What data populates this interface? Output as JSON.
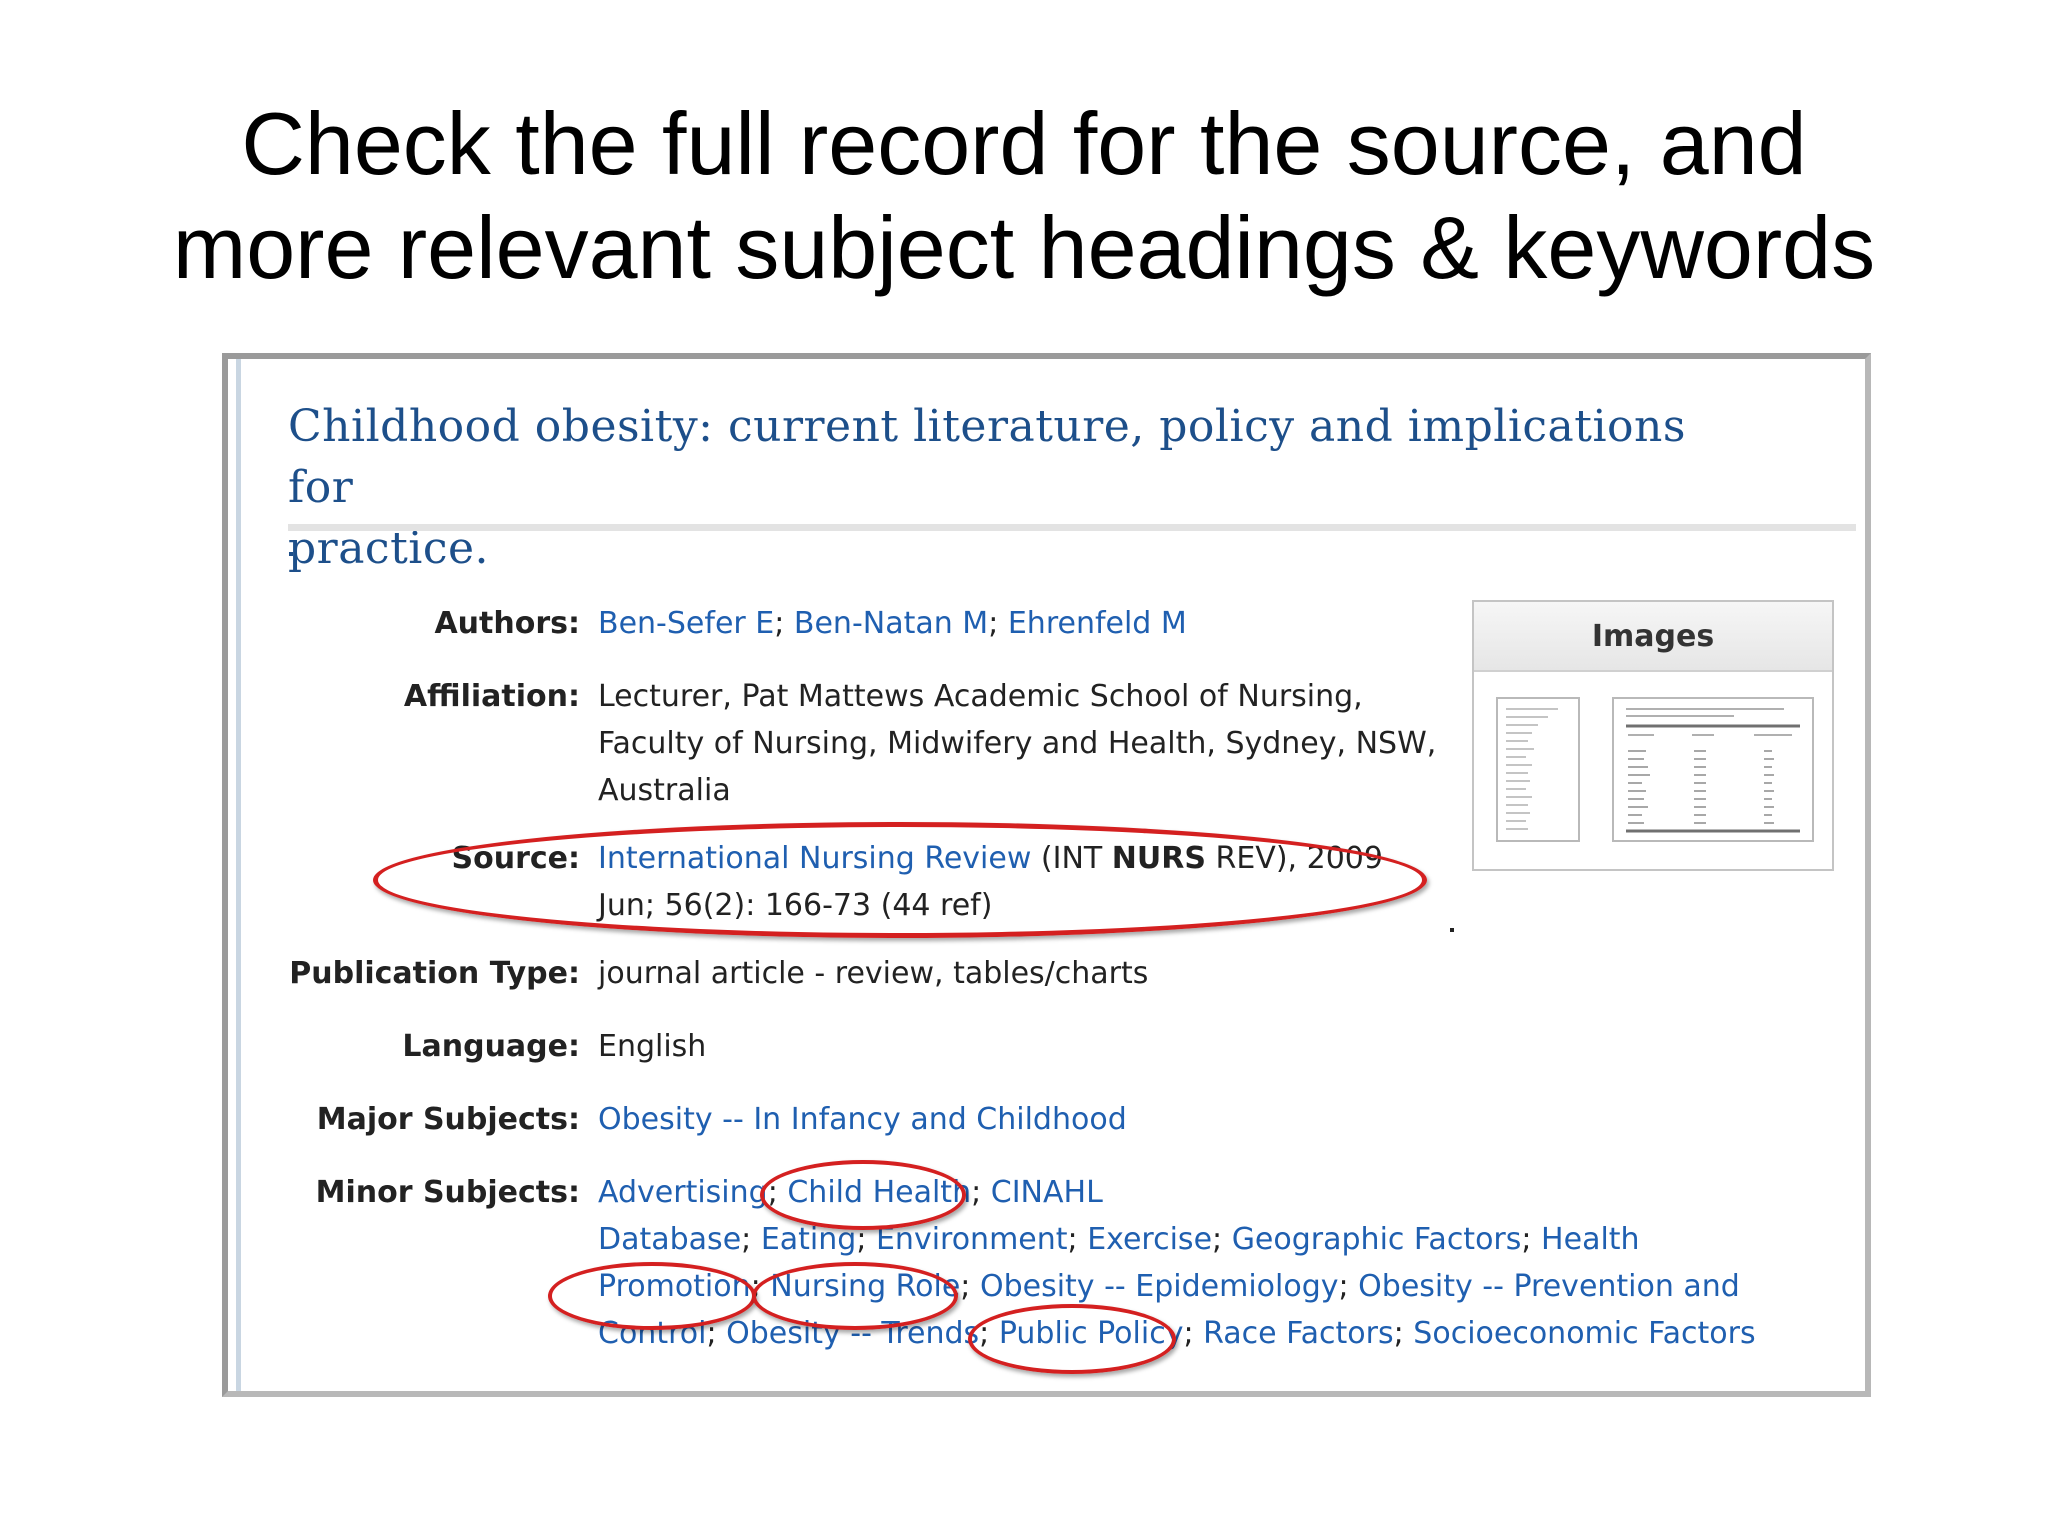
{
  "slide": {
    "title_line1": "Check the full record for the source, and",
    "title_line2": "more relevant subject headings & keywords"
  },
  "record": {
    "title_line1": "Childhood obesity: current literature, policy and implications for",
    "title_line2": "practice.",
    "authors": {
      "label": "Authors:",
      "names": [
        "Ben-Sefer E",
        "Ben-Natan M",
        "Ehrenfeld M"
      ],
      "separator": "; "
    },
    "affiliation": {
      "label": "Affiliation:",
      "lines": [
        "Lecturer, Pat Mattews Academic School of Nursing,",
        "Faculty of Nursing, Midwifery and Health, Sydney, NSW,",
        "Australia"
      ]
    },
    "source": {
      "label": "Source:",
      "journal": "International Nursing Review",
      "abbr_open": " (INT ",
      "abbr_bold": "NURS",
      "abbr_close": " REV), 2009",
      "line2": "Jun; 56(2): 166-73 (44 ref)"
    },
    "publication_type": {
      "label": "Publication Type:",
      "value": "journal article - review, tables/charts"
    },
    "language": {
      "label": "Language:",
      "value": "English"
    },
    "major_subjects": {
      "label": "Major Subjects:",
      "value": "Obesity -- In Infancy and Childhood"
    },
    "minor_subjects": {
      "label": "Minor Subjects:",
      "sep": "; ",
      "items": {
        "advertising": "Advertising",
        "child_health": "Child Health",
        "cinahl": "CINAHL",
        "database": "Database",
        "eating": "Eating",
        "environment": "Environment",
        "exercise": "Exercise",
        "geographic_factors": "Geographic Factors",
        "health": "Health",
        "promotion": "Promotion",
        "nursing_role": "Nursing Role",
        "obesity_epidemiology": "Obesity -- Epidemiology",
        "obesity_prevention": "Obesity -- Prevention and",
        "control": "Control",
        "obesity_trends": "Obesity -- Trends",
        "public_policy": "Public Policy",
        "race_factors": "Race Factors",
        "socioeconomic_factors": "Socioeconomic Factors"
      }
    }
  },
  "images_panel": {
    "heading": "Images"
  },
  "colors": {
    "link": "#1f5fb0",
    "title": "#1d4f8a",
    "highlight_ring": "#d42020"
  }
}
